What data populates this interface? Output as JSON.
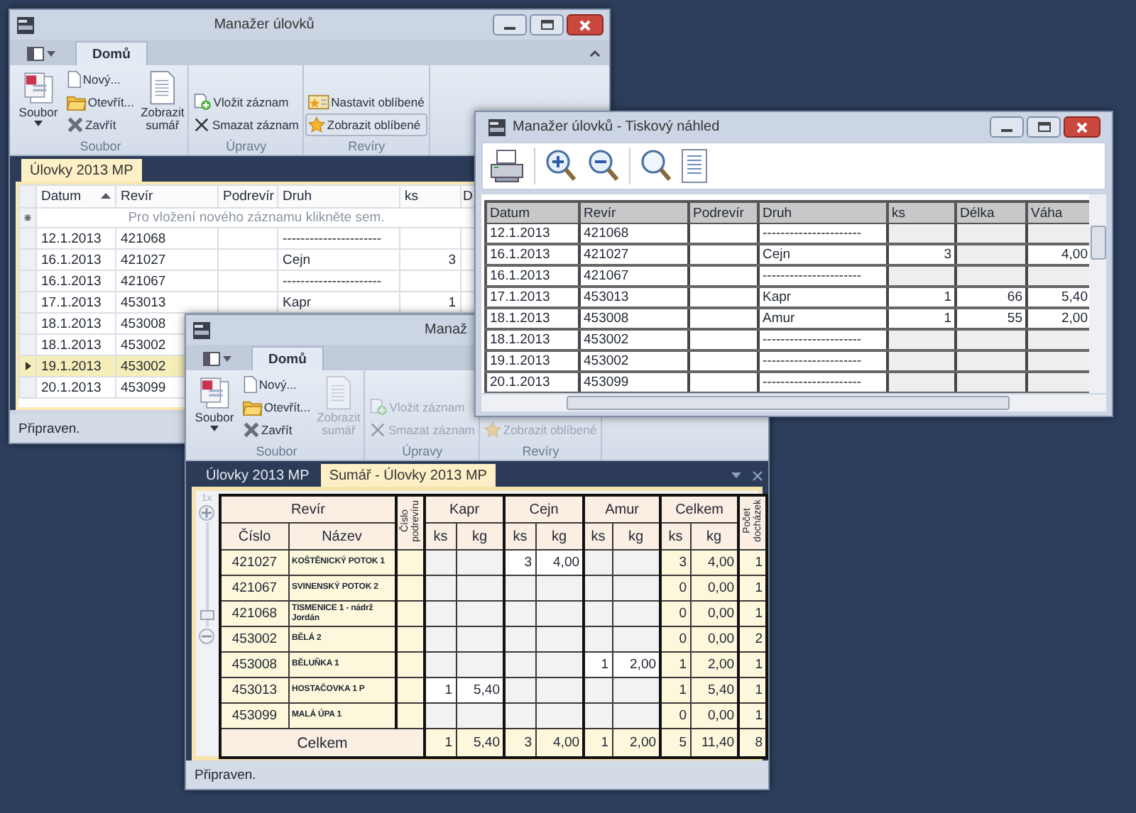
{
  "main_window": {
    "title": "Manažer úlovků",
    "ribbon": {
      "tabs": [
        {
          "label": "Domů",
          "selected": true
        }
      ],
      "groups": [
        {
          "label": "Soubor",
          "items": [
            {
              "kind": "file",
              "label": "Soubor",
              "disabled": false,
              "pressed": false
            },
            {
              "kind": "new",
              "label": "Nový...",
              "disabled": false,
              "pressed": false
            },
            {
              "kind": "open",
              "label": "Otevřít...",
              "disabled": false,
              "pressed": false
            },
            {
              "kind": "close",
              "label": "Zavřít",
              "disabled": false,
              "pressed": false
            },
            {
              "kind": "summary",
              "label": "Zobrazit sumář",
              "disabled": false,
              "pressed": false
            }
          ]
        },
        {
          "label": "Úpravy",
          "items": [
            {
              "kind": "insert",
              "label": "Vložit záznam",
              "disabled": false,
              "pressed": false
            },
            {
              "kind": "delete",
              "label": "Smazat záznam",
              "disabled": false,
              "pressed": false
            }
          ]
        },
        {
          "label": "Revíry",
          "items": [
            {
              "kind": "setfav",
              "label": "Nastavit oblíbené",
              "disabled": false,
              "pressed": false
            },
            {
              "kind": "showfav",
              "label": "Zobrazit oblíbené",
              "disabled": false,
              "pressed": true
            }
          ]
        }
      ]
    },
    "doc_tabs": [
      {
        "label": "Úlovky 2013 MP",
        "selected": true
      }
    ],
    "grid": {
      "columns": [
        {
          "label": "Datum",
          "sorted": true
        },
        {
          "label": "Revír",
          "sorted": false
        },
        {
          "label": "Podrevír",
          "sorted": false
        },
        {
          "label": "Druh",
          "sorted": false
        },
        {
          "label": "ks",
          "sorted": false
        },
        {
          "label": "D",
          "sorted": false
        }
      ],
      "new_row_hint": "Pro vložení nového záznamu klikněte sem.",
      "rows": [
        {
          "datum": "12.1.2013",
          "revir": "421068",
          "druh": "----------------------",
          "selected": false
        },
        {
          "datum": "16.1.2013",
          "revir": "421027",
          "druh": "Cejn",
          "ks": "3",
          "selected": false
        },
        {
          "datum": "16.1.2013",
          "revir": "421067",
          "druh": "----------------------",
          "selected": false
        },
        {
          "datum": "17.1.2013",
          "revir": "453013",
          "druh": "Kapr",
          "ks": "1",
          "selected": false
        },
        {
          "datum": "18.1.2013",
          "revir": "453008",
          "selected": false
        },
        {
          "datum": "18.1.2013",
          "revir": "453002",
          "selected": false
        },
        {
          "datum": "19.1.2013",
          "revir": "453002",
          "selected": true
        },
        {
          "datum": "20.1.2013",
          "revir": "453099",
          "selected": false
        }
      ]
    },
    "status_bar": "Připraven."
  },
  "summary_window": {
    "title": "Manaž",
    "ribbon": {
      "tabs": [
        {
          "label": "Domů",
          "selected": true
        }
      ],
      "groups": [
        {
          "label": "Soubor",
          "items": [
            {
              "kind": "file",
              "label": "Soubor",
              "disabled": false,
              "pressed": false
            },
            {
              "kind": "new",
              "label": "Nový...",
              "disabled": false,
              "pressed": false
            },
            {
              "kind": "open",
              "label": "Otevřít...",
              "disabled": false,
              "pressed": false
            },
            {
              "kind": "close",
              "label": "Zavřít",
              "disabled": false,
              "pressed": false
            },
            {
              "kind": "summary",
              "label": "Zobrazit sumář",
              "disabled": true,
              "pressed": false
            }
          ]
        },
        {
          "label": "Úpravy",
          "items": [
            {
              "kind": "insert",
              "label": "Vložit záznam",
              "disabled": true,
              "pressed": false
            },
            {
              "kind": "delete",
              "label": "Smazat záznam",
              "disabled": true,
              "pressed": false
            }
          ]
        },
        {
          "label": "Revíry",
          "items": [
            {
              "kind": "showfav",
              "label": "Zobrazit oblíbené",
              "disabled": true,
              "pressed": false
            }
          ]
        }
      ]
    },
    "doc_tabs": [
      {
        "label": "Úlovky 2013 MP",
        "selected": false
      },
      {
        "label": "Sumář - Úlovky 2013 MP",
        "selected": true
      }
    ],
    "zoom_slider": {
      "label": "1x",
      "level": 0.12
    },
    "summary": {
      "revir": "Revír",
      "cislo": "Číslo",
      "nazev": "Název",
      "podrevir": "Číslo podrevíru",
      "visits": "Počet docházek",
      "groups": [
        {
          "label": "Kapr",
          "sub": [
            "ks",
            "kg"
          ]
        },
        {
          "label": "Cejn",
          "sub": [
            "ks",
            "kg"
          ]
        },
        {
          "label": "Amur",
          "sub": [
            "ks",
            "kg"
          ]
        },
        {
          "label": "Celkem",
          "sub": [
            "ks",
            "kg"
          ]
        }
      ],
      "rows": [
        {
          "cislo": "421027",
          "nazev": "KOŠTĚNICKÝ POTOK 1",
          "catches": [
            {
              "filled": false
            },
            {
              "filled": true,
              "ks": "3",
              "kg": "4,00"
            },
            {
              "filled": false
            }
          ],
          "total": {
            "ks": "3",
            "kg": "4,00"
          },
          "visits": "1"
        },
        {
          "cislo": "421067",
          "nazev": "SVINENSKÝ POTOK 2",
          "catches": [
            {
              "filled": false
            },
            {
              "filled": false
            },
            {
              "filled": false
            }
          ],
          "total": {
            "ks": "0",
            "kg": "0,00"
          },
          "visits": "1"
        },
        {
          "cislo": "421068",
          "nazev": "TISMENICE 1 - nádrž Jordán",
          "catches": [
            {
              "filled": false
            },
            {
              "filled": false
            },
            {
              "filled": false
            }
          ],
          "total": {
            "ks": "0",
            "kg": "0,00"
          },
          "visits": "1"
        },
        {
          "cislo": "453002",
          "nazev": "BĚLÁ 2",
          "catches": [
            {
              "filled": false
            },
            {
              "filled": false
            },
            {
              "filled": false
            }
          ],
          "total": {
            "ks": "0",
            "kg": "0,00"
          },
          "visits": "2"
        },
        {
          "cislo": "453008",
          "nazev": "BĚLUŇKA 1",
          "catches": [
            {
              "filled": false
            },
            {
              "filled": false
            },
            {
              "filled": true,
              "ks": "1",
              "kg": "2,00"
            }
          ],
          "total": {
            "ks": "1",
            "kg": "2,00"
          },
          "visits": "1"
        },
        {
          "cislo": "453013",
          "nazev": "HOSTAČOVKA 1 P",
          "catches": [
            {
              "filled": true,
              "ks": "1",
              "kg": "5,40"
            },
            {
              "filled": false
            },
            {
              "filled": false
            }
          ],
          "total": {
            "ks": "1",
            "kg": "5,40"
          },
          "visits": "1"
        },
        {
          "cislo": "453099",
          "nazev": "MALÁ ÚPA 1",
          "catches": [
            {
              "filled": false
            },
            {
              "filled": false
            },
            {
              "filled": false
            }
          ],
          "total": {
            "ks": "0",
            "kg": "0,00"
          },
          "visits": "1"
        }
      ],
      "footer": {
        "label": "Celkem",
        "catches": [
          {
            "ks": "1",
            "kg": "5,40"
          },
          {
            "ks": "3",
            "kg": "4,00"
          },
          {
            "ks": "1",
            "kg": "2,00"
          }
        ],
        "total": {
          "ks": "5",
          "kg": "11,40"
        },
        "visits": "8"
      }
    },
    "status_bar": "Připraven."
  },
  "preview_window": {
    "title": "Manažer úlovků - Tiskový náhled",
    "table": {
      "columns": [
        "Datum",
        "Revír",
        "Podrevír",
        "Druh",
        "ks",
        "Délka",
        "Váha"
      ],
      "rows": [
        {
          "datum": "12.1.2013",
          "revir": "421068",
          "druh": "----------------------"
        },
        {
          "datum": "16.1.2013",
          "revir": "421027",
          "druh": "Cejn",
          "ks": "3",
          "vaha": "4,00"
        },
        {
          "datum": "16.1.2013",
          "revir": "421067",
          "druh": "----------------------"
        },
        {
          "datum": "17.1.2013",
          "revir": "453013",
          "druh": "Kapr",
          "ks": "1",
          "delka": "66",
          "vaha": "5,40"
        },
        {
          "datum": "18.1.2013",
          "revir": "453008",
          "druh": "Amur",
          "ks": "1",
          "delka": "55",
          "vaha": "2,00"
        },
        {
          "datum": "18.1.2013",
          "revir": "453002",
          "druh": "----------------------"
        },
        {
          "datum": "19.1.2013",
          "revir": "453002",
          "druh": "----------------------"
        },
        {
          "datum": "20.1.2013",
          "revir": "453099",
          "druh": "----------------------"
        }
      ]
    }
  }
}
